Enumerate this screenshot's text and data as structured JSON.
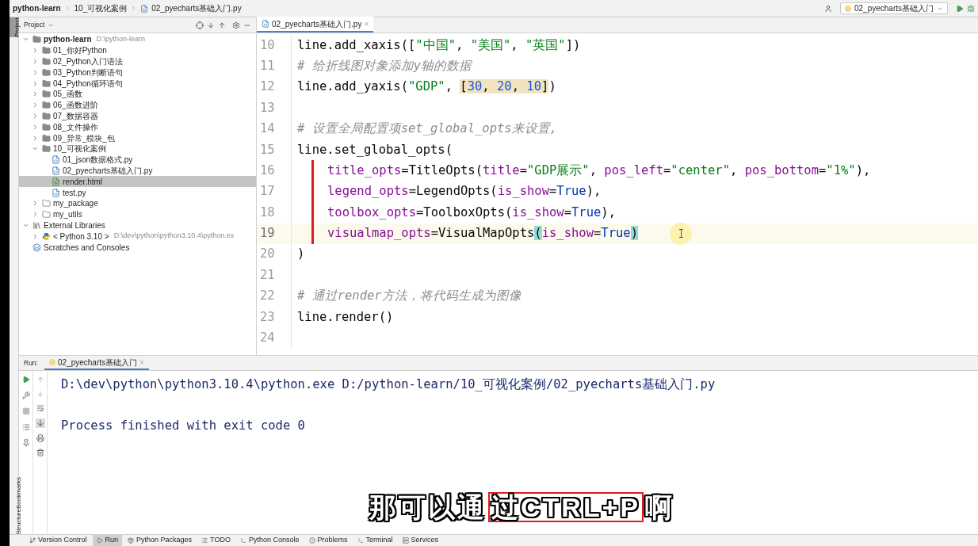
{
  "breadcrumb": [
    "python-learn",
    "10_可视化案例",
    "02_pyecharts基础入门.py"
  ],
  "run_config": "02_pyecharts基础入门",
  "side_tabs_left": [
    {
      "label": "Project",
      "selected": true
    }
  ],
  "side_tabs_bottom": [
    "Bookmarks",
    "Structure"
  ],
  "project_panel": {
    "title": "Project"
  },
  "tree": [
    {
      "label": "python-learn",
      "hint": "D:\\python-learn",
      "kind": "folder",
      "expanded": true,
      "selected": false,
      "children": [
        {
          "label": "01_你好Python",
          "kind": "folder",
          "expanded": false,
          "selected": false
        },
        {
          "label": "02_Python入门语法",
          "kind": "folder",
          "expanded": false,
          "selected": false
        },
        {
          "label": "03_Python判断语句",
          "kind": "folder",
          "expanded": false,
          "selected": false
        },
        {
          "label": "04_Python循环语句",
          "kind": "folder",
          "expanded": false,
          "selected": false
        },
        {
          "label": "05_函数",
          "kind": "folder",
          "expanded": false,
          "selected": false
        },
        {
          "label": "06_函数进阶",
          "kind": "folder",
          "expanded": false,
          "selected": false
        },
        {
          "label": "07_数据容器",
          "kind": "folder",
          "expanded": false,
          "selected": false
        },
        {
          "label": "08_文件操作",
          "kind": "folder",
          "expanded": false,
          "selected": false
        },
        {
          "label": "09_异常_模块_包",
          "kind": "folder",
          "expanded": false,
          "selected": false
        },
        {
          "label": "10_可视化案例",
          "kind": "folder",
          "expanded": true,
          "selected": false,
          "children": [
            {
              "label": "01_json数据格式.py",
              "kind": "pyfile",
              "selected": false
            },
            {
              "label": "02_pyecharts基础入门.py",
              "kind": "pyfile",
              "selected": false
            },
            {
              "label": "render.html",
              "kind": "htmlfile",
              "selected": true
            },
            {
              "label": "test.py",
              "kind": "pyfile",
              "selected": false
            }
          ]
        },
        {
          "label": "my_package",
          "kind": "package",
          "expanded": false,
          "selected": false
        },
        {
          "label": "my_utils",
          "kind": "package",
          "expanded": false,
          "selected": false
        }
      ]
    },
    {
      "label": "External Libraries",
      "kind": "library",
      "expanded": true,
      "selected": false,
      "children": [
        {
          "label": "< Python 3.10 >",
          "hint": "D:\\dev\\python\\python3.10.4\\python.ex",
          "kind": "sdk",
          "expanded": false,
          "selected": false
        }
      ]
    },
    {
      "label": "Scratches and Consoles",
      "kind": "scratches",
      "selected": false
    }
  ],
  "editor_tab": {
    "label": "02_pyecharts基础入门.py",
    "close": "×",
    "selected": true
  },
  "code_lines": [
    {
      "number": "10",
      "current": false,
      "tokens": [
        {
          "kind": "plain",
          "text": "line.add_xaxis(["
        },
        {
          "kind": "string",
          "text": "\"中国\""
        },
        {
          "kind": "plain",
          "text": ", "
        },
        {
          "kind": "string",
          "text": "\"美国\""
        },
        {
          "kind": "plain",
          "text": ", "
        },
        {
          "kind": "string",
          "text": "\"英国\""
        },
        {
          "kind": "plain",
          "text": "])"
        }
      ]
    },
    {
      "number": "11",
      "current": false,
      "tokens": [
        {
          "kind": "comment",
          "text": "# 给折线图对象添加y轴的数据"
        }
      ]
    },
    {
      "number": "12",
      "current": false,
      "tokens": [
        {
          "kind": "plain",
          "text": "line.add_yaxis("
        },
        {
          "kind": "string",
          "text": "\"GDP\""
        },
        {
          "kind": "plain",
          "text": ", "
        },
        {
          "kind": "plain",
          "text": "[",
          "highlighted": true
        },
        {
          "kind": "number",
          "text": "30",
          "highlighted": true
        },
        {
          "kind": "plain",
          "text": ", ",
          "highlighted": true
        },
        {
          "kind": "number",
          "text": "20",
          "highlighted": true
        },
        {
          "kind": "plain",
          "text": ", ",
          "highlighted": true
        },
        {
          "kind": "number",
          "text": "10",
          "highlighted": true
        },
        {
          "kind": "plain",
          "text": "]",
          "highlighted": true
        },
        {
          "kind": "plain",
          "text": ")"
        }
      ]
    },
    {
      "number": "13",
      "current": false
    },
    {
      "number": "14",
      "current": false,
      "tokens": [
        {
          "kind": "comment",
          "text": "# 设置全局配置项set_global_opts来设置,"
        }
      ]
    },
    {
      "number": "15",
      "current": false,
      "tokens": [
        {
          "kind": "plain",
          "text": "line.set_global_opts("
        }
      ],
      "children": [
        {
          "number": "16",
          "current": false,
          "marked": true,
          "tokens": [
            {
              "kind": "param",
              "text": "title_opts"
            },
            {
              "kind": "plain",
              "text": "=TitleOpts("
            },
            {
              "kind": "param",
              "text": "title"
            },
            {
              "kind": "plain",
              "text": "="
            },
            {
              "kind": "string",
              "text": "\"GDP展示\""
            },
            {
              "kind": "plain",
              "text": ", "
            },
            {
              "kind": "param",
              "text": "pos_left"
            },
            {
              "kind": "plain",
              "text": "="
            },
            {
              "kind": "string",
              "text": "\"center\""
            },
            {
              "kind": "plain",
              "text": ", "
            },
            {
              "kind": "param",
              "text": "pos_bottom"
            },
            {
              "kind": "plain",
              "text": "="
            },
            {
              "kind": "string",
              "text": "\"1%\""
            },
            {
              "kind": "plain",
              "text": "),"
            }
          ]
        },
        {
          "number": "17",
          "current": false,
          "marked": true,
          "tokens": [
            {
              "kind": "param",
              "text": "legend_opts"
            },
            {
              "kind": "plain",
              "text": "=LegendOpts("
            },
            {
              "kind": "param",
              "text": "is_show"
            },
            {
              "kind": "plain",
              "text": "="
            },
            {
              "kind": "keyword",
              "text": "True"
            },
            {
              "kind": "plain",
              "text": "),"
            }
          ]
        },
        {
          "number": "18",
          "current": false,
          "marked": true,
          "tokens": [
            {
              "kind": "param",
              "text": "toolbox_opts"
            },
            {
              "kind": "plain",
              "text": "=ToolboxOpts("
            },
            {
              "kind": "param",
              "text": "is_show"
            },
            {
              "kind": "plain",
              "text": "="
            },
            {
              "kind": "keyword",
              "text": "True"
            },
            {
              "kind": "plain",
              "text": "),"
            }
          ]
        },
        {
          "number": "19",
          "current": true,
          "marked": true,
          "tokens": [
            {
              "kind": "param",
              "text": "visualmap_opts"
            },
            {
              "kind": "plain",
              "text": "=VisualMapOpts"
            },
            {
              "kind": "brace",
              "text": "("
            },
            {
              "kind": "param",
              "text": "is_show"
            },
            {
              "kind": "plain",
              "text": "="
            },
            {
              "kind": "keyword",
              "text": "True"
            },
            {
              "kind": "brace",
              "text": ")"
            }
          ]
        }
      ]
    },
    {
      "number": "20",
      "current": false,
      "tokens": [
        {
          "kind": "plain",
          "text": ")"
        }
      ]
    },
    {
      "number": "21",
      "current": false
    },
    {
      "number": "22",
      "current": false,
      "tokens": [
        {
          "kind": "comment",
          "text": "# 通过render方法，将代码生成为图像"
        }
      ]
    },
    {
      "number": "23",
      "current": false,
      "tokens": [
        {
          "kind": "plain",
          "text": "line.render()"
        }
      ]
    },
    {
      "number": "24",
      "current": false
    }
  ],
  "run_panel": {
    "label": "Run:",
    "tab": "02_pyecharts基础入门",
    "close": "×",
    "output": [
      "D:\\dev\\python\\python3.10.4\\python.exe D:/python-learn/10_可视化案例/02_pyecharts基础入门.py",
      "Process finished with exit code 0"
    ]
  },
  "subtitle": [
    {
      "text": "那可以通",
      "highlighted": false
    },
    {
      "text": "过CTRL+P",
      "highlighted": true
    },
    {
      "text": "啊",
      "highlighted": false
    }
  ],
  "status_tabs": [
    {
      "label": "Version Control",
      "selected": false
    },
    {
      "label": "Run",
      "selected": true
    },
    {
      "label": "Python Packages",
      "selected": false
    },
    {
      "label": "TODO",
      "selected": false
    },
    {
      "label": "Python Console",
      "selected": false
    },
    {
      "label": "Problems",
      "selected": false
    },
    {
      "label": "Terminal",
      "selected": false
    },
    {
      "label": "Services",
      "selected": false
    }
  ]
}
